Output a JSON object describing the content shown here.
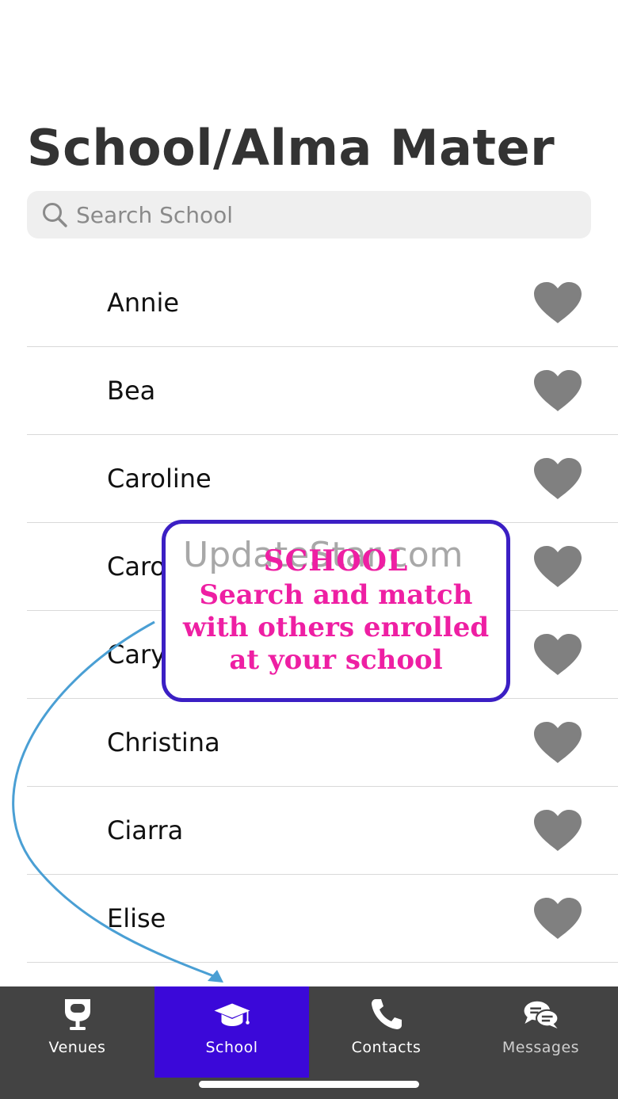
{
  "header": {
    "title": "School/Alma Mater"
  },
  "search": {
    "placeholder": "Search School",
    "icon": "search-icon"
  },
  "list": {
    "items": [
      {
        "name": "Annie",
        "icon": "heart-icon"
      },
      {
        "name": "Bea",
        "icon": "heart-icon"
      },
      {
        "name": "Caroline",
        "icon": "heart-icon"
      },
      {
        "name": "Caro",
        "icon": "heart-icon"
      },
      {
        "name": "Cary",
        "icon": "heart-icon"
      },
      {
        "name": "Christina",
        "icon": "heart-icon"
      },
      {
        "name": "Ciarra",
        "icon": "heart-icon"
      },
      {
        "name": "Elise",
        "icon": "heart-icon"
      }
    ]
  },
  "callout": {
    "watermark": "UpdateStar.com",
    "heading": "SCHOOL",
    "line1": "Search and match",
    "line2": "with others enrolled",
    "line3": "at your school"
  },
  "tabbar": {
    "tabs": [
      {
        "label": "Venues",
        "icon": "wine-glass-icon"
      },
      {
        "label": "School",
        "icon": "graduation-cap-icon",
        "active": true
      },
      {
        "label": "Contacts",
        "icon": "phone-icon"
      },
      {
        "label": "Messages",
        "icon": "chat-bubbles-icon"
      }
    ]
  },
  "colors": {
    "accent": "#3b08d9",
    "callout_border": "#3b1fc4",
    "callout_text": "#ee1fa3",
    "heart": "#808080",
    "tabbar_bg": "#434343",
    "arrow": "#4a9fd4"
  }
}
